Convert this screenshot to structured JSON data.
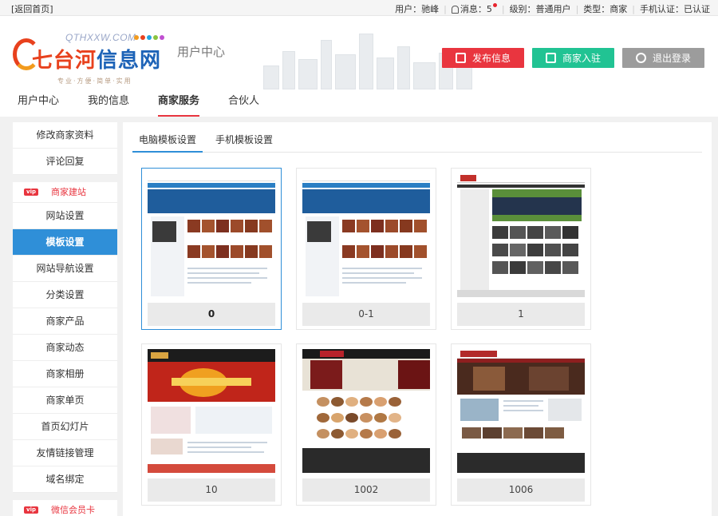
{
  "topbar": {
    "back_label": "[返回首页]",
    "user": "用户：驰峰",
    "messages": "消息：5",
    "level": "级别：普通用户",
    "type": "类型：商家",
    "phone": "手机认证：已认证"
  },
  "header": {
    "logo_domain": "QTHXXW.COM",
    "logo_name_a": "七台河",
    "logo_name_b": "信息网",
    "logo_slogan": "专业·方便·简单·实用",
    "page_title": "用户中心",
    "publish_label": "发布信息",
    "join_label": "商家入驻",
    "logout_label": "退出登录"
  },
  "mainnav": [
    {
      "label": "用户中心"
    },
    {
      "label": "我的信息"
    },
    {
      "label": "商家服务"
    },
    {
      "label": "合伙人"
    }
  ],
  "sidebar": {
    "group1": [
      {
        "label": "修改商家资料"
      },
      {
        "label": "评论回复"
      }
    ],
    "site_head": "商家建站",
    "group2": [
      {
        "label": "网站设置"
      },
      {
        "label": "模板设置"
      },
      {
        "label": "网站导航设置"
      },
      {
        "label": "分类设置"
      },
      {
        "label": "商家产品"
      },
      {
        "label": "商家动态"
      },
      {
        "label": "商家相册"
      },
      {
        "label": "商家单页"
      },
      {
        "label": "首页幻灯片"
      },
      {
        "label": "友情链接管理"
      },
      {
        "label": "域名绑定"
      }
    ],
    "wechat_head": "微信会员卡",
    "vip_badge": "vip"
  },
  "tabs": [
    {
      "label": "电脑模板设置"
    },
    {
      "label": "手机模板设置"
    }
  ],
  "templates": [
    {
      "name": "0"
    },
    {
      "name": "0-1"
    },
    {
      "name": "1"
    },
    {
      "name": "10"
    },
    {
      "name": "1002"
    },
    {
      "name": "1006"
    }
  ],
  "colors": {
    "accent_blue": "#2f8fd8",
    "accent_red": "#e8353f",
    "green": "#21c393",
    "gray_button": "#9c9c9c"
  }
}
